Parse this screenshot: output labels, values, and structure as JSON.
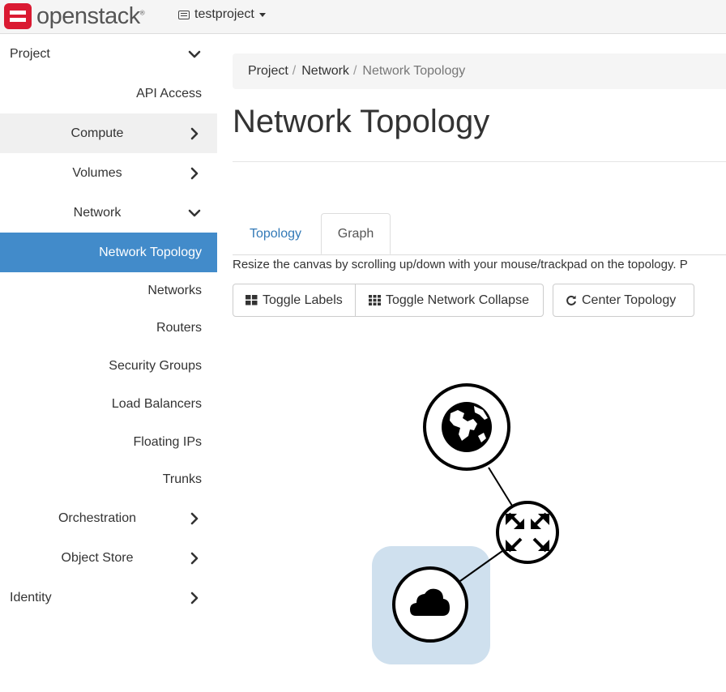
{
  "header": {
    "brand": "openstack",
    "brand_mark": "®",
    "project": "testproject"
  },
  "sidebar": {
    "items": [
      {
        "label": "Project",
        "level": 0,
        "chevron": "down"
      },
      {
        "label": "API Access",
        "level": 2,
        "chevron": ""
      },
      {
        "label": "Compute",
        "level": 1,
        "chevron": "right",
        "highlight": true
      },
      {
        "label": "Volumes",
        "level": 1,
        "chevron": "right"
      },
      {
        "label": "Network",
        "level": 1,
        "chevron": "down"
      },
      {
        "label": "Network Topology",
        "level": 2,
        "chevron": "",
        "active": true
      },
      {
        "label": "Networks",
        "level": 2,
        "chevron": ""
      },
      {
        "label": "Routers",
        "level": 2,
        "chevron": ""
      },
      {
        "label": "Security Groups",
        "level": 2,
        "chevron": ""
      },
      {
        "label": "Load Balancers",
        "level": 2,
        "chevron": ""
      },
      {
        "label": "Floating IPs",
        "level": 2,
        "chevron": ""
      },
      {
        "label": "Trunks",
        "level": 2,
        "chevron": ""
      },
      {
        "label": "Orchestration",
        "level": 1,
        "chevron": "right"
      },
      {
        "label": "Object Store",
        "level": 1,
        "chevron": "right"
      },
      {
        "label": "Identity",
        "level": 0,
        "chevron": "right"
      }
    ]
  },
  "breadcrumb": [
    "Project",
    "Network",
    "Network Topology"
  ],
  "page": {
    "title": "Network Topology",
    "tabs": [
      "Topology",
      "Graph"
    ],
    "help_text": "Resize the canvas by scrolling up/down with your mouse/trackpad on the topology. P",
    "buttons": {
      "toggle_labels": "Toggle Labels",
      "toggle_collapse": "Toggle Network Collapse",
      "center": "Center Topology"
    }
  },
  "topology": {
    "nodes": [
      "external-network-globe-icon",
      "router-icon",
      "network-cloud-icon"
    ]
  },
  "colors": {
    "active_bg": "#428bca",
    "link": "#337ab7",
    "brand_red": "#da1a32",
    "network_halo": "#cfe0ee"
  }
}
